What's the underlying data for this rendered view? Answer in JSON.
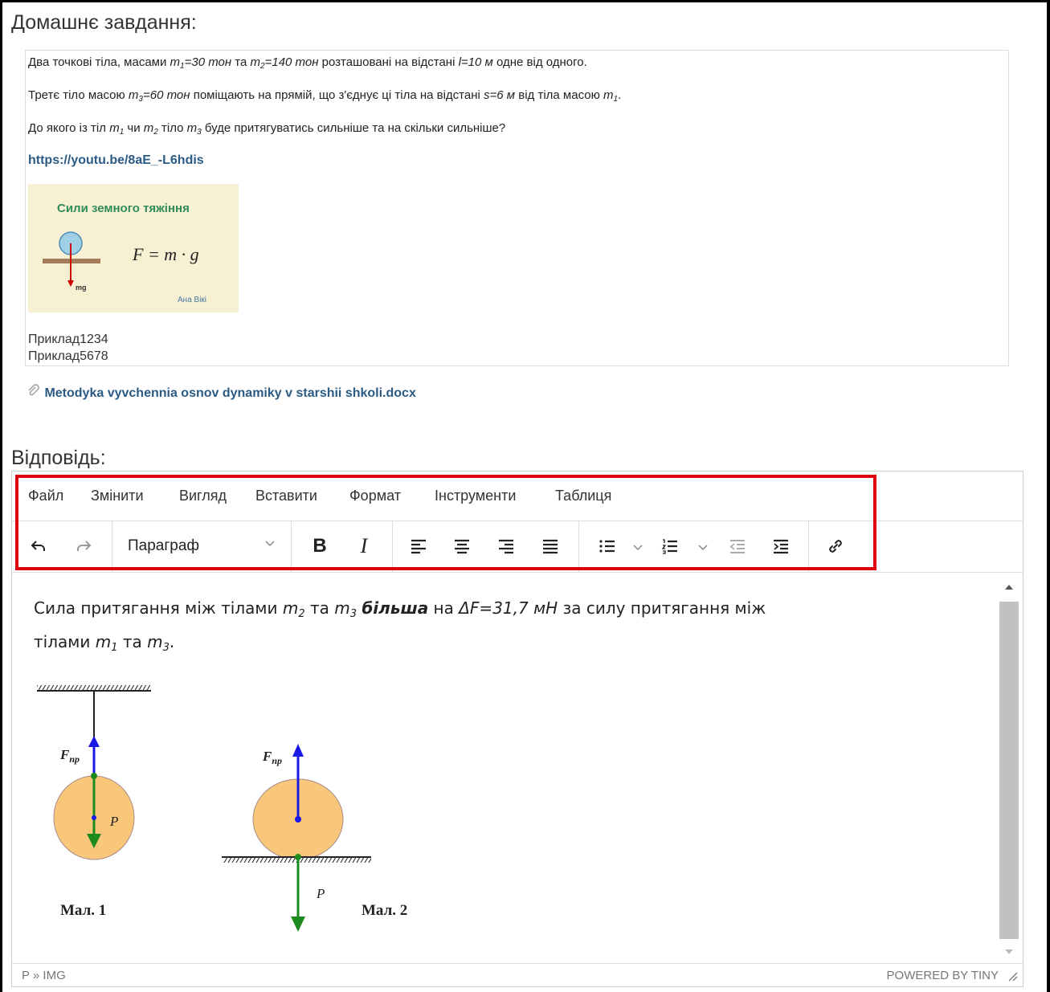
{
  "homework": {
    "title": "Домашнє завдання:",
    "line1": {
      "a": "Два точкові тіла, масами ",
      "m1": "m",
      "m1sub": "1",
      "m1val": "=30 тон",
      "b": " та ",
      "m2": "m",
      "m2sub": "2",
      "m2val": "=140 тон",
      "c": " розташовані на відстані ",
      "l": "l=10 м",
      "d": " одне від одного."
    },
    "line2": {
      "a": "Третє тіло масою ",
      "m3": "m",
      "m3sub": "3",
      "m3val": "=60 тон",
      "b": " поміщають на прямій, що з'єднує ці тіла на відстані ",
      "s": "s=6 м",
      "c": " від тіла масою ",
      "m1": "m",
      "m1sub": "1",
      "d": "."
    },
    "line3": {
      "a": "До якого із тіл ",
      "m1": "m",
      "m1sub": "1",
      "b": " чи ",
      "m2": "m",
      "m2sub": "2",
      "c": " тіло ",
      "m3": "m",
      "m3sub": "3",
      "d": " буде притягуватись сильніше та на скільки сильніше?"
    },
    "link": "https://youtu.be/8aE_-L6hdis",
    "thumb": {
      "title": "Сили земного тяжіння",
      "formula": "F = m · g",
      "mg": "mg",
      "brand": "Ана Вікі"
    },
    "example1": "Приклад1234",
    "example2": "Приклад5678",
    "attachment": "Metodyka vyvchennia osnov dynamiky v starshii shkoli.docx",
    "attach_icon": "paperclip-icon"
  },
  "answer": {
    "title": "Відповідь:",
    "menu": [
      "Файл",
      "Змінити",
      "Вигляд",
      "Вставити",
      "Формат",
      "Інструменти",
      "Таблиця"
    ],
    "toolbar": {
      "block_format": "Параграф",
      "bold": "B",
      "italic": "I"
    },
    "content": {
      "a": "Сила притягання між тілами ",
      "m2": "m",
      "m2sub": "2",
      "b": " та ",
      "m3": "m",
      "m3sub": "3",
      "c": " ",
      "bigger": "більша",
      "d": " на ",
      "df": "ΔF=31,7 мН",
      "e": " за силу притягання між",
      "f": "тілами ",
      "m1": "m",
      "m1sub": "1",
      "g": " та ",
      "m3b": "m",
      "m3bsub": "3",
      "h": "."
    },
    "figure": {
      "fnp": "F",
      "fnp_sub": "пр",
      "p": "P",
      "cap1": "Мал. 1",
      "cap2": "Мал. 2"
    },
    "statusbar": {
      "path": "P » IMG",
      "powered": "POWERED BY TINY"
    }
  },
  "colors": {
    "link": "#2b5a84",
    "highlight": "#e0000d",
    "ball": "#f9c77a",
    "arrow_blue": "#1a1ae6",
    "arrow_green": "#1c8a1c"
  }
}
